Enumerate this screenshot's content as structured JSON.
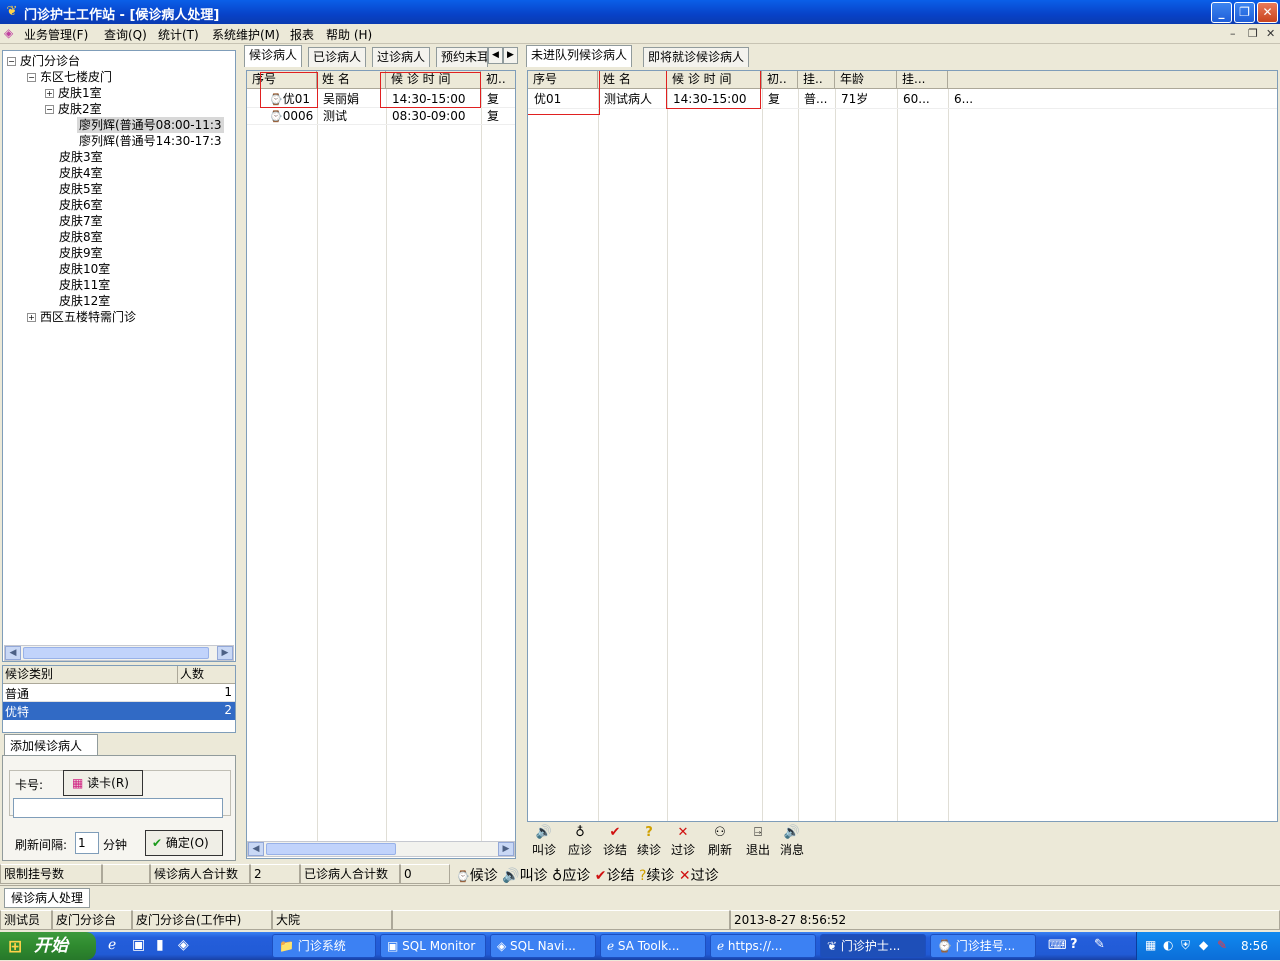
{
  "window": {
    "title": "门诊护士工作站 - [候诊病人处理]"
  },
  "menu": [
    "业务管理(F)",
    "查询(Q)",
    "统计(T)",
    "系统维护(M)",
    "报表",
    "帮助 (H)"
  ],
  "tree": {
    "root": "皮门分诊台",
    "east": "东区七楼皮门",
    "room1": "皮肤1室",
    "room2": "皮肤2室",
    "doctor1": "廖列辉(普通号08:00-11:3",
    "doctor2": "廖列辉(普通号14:30-17:3",
    "rooms": [
      "皮肤3室",
      "皮肤4室",
      "皮肤5室",
      "皮肤6室",
      "皮肤7室",
      "皮肤8室",
      "皮肤9室",
      "皮肤10室",
      "皮肤11室",
      "皮肤12室"
    ],
    "west": "西区五楼特需门诊"
  },
  "category_table": {
    "headers": [
      "候诊类别",
      "人数"
    ],
    "rows": [
      {
        "name": "普通",
        "count": "1"
      },
      {
        "name": "优特",
        "count": "2"
      }
    ]
  },
  "add_patient": {
    "tab": "添加候诊病人",
    "card_label": "卡号:",
    "read_card": "读卡(R)",
    "card_value": "",
    "interval_label": "刷新间隔:",
    "interval_value": "1",
    "interval_unit": "分钟",
    "ok": "确定(O)"
  },
  "left_tabs": [
    "候诊病人",
    "已诊病人",
    "过诊病人",
    "预约未耳"
  ],
  "left_grid": {
    "headers": [
      "序号",
      "姓  名",
      "候 诊 时 间",
      "初.."
    ],
    "rows": [
      {
        "seq": "优01",
        "name": "吴丽娟",
        "time": "14:30-15:00",
        "type": "复"
      },
      {
        "seq": "0006",
        "name": "测试",
        "time": "08:30-09:00",
        "type": "复"
      }
    ]
  },
  "right_tabs": [
    "未进队列候诊病人",
    "即将就诊候诊病人"
  ],
  "right_grid": {
    "headers": [
      "序号",
      "姓  名",
      "候 诊 时 间",
      "初..",
      "挂..",
      "年龄",
      "挂..."
    ],
    "rows": [
      {
        "seq": "优01",
        "name": "测试病人",
        "time": "14:30-15:00",
        "type": "复",
        "reg": "普...",
        "age": "71岁",
        "fee": "60...",
        "extra": "6..."
      }
    ]
  },
  "toolbar": [
    "叫诊",
    "应诊",
    "诊结",
    "续诊",
    "过诊",
    "刷新",
    "退出",
    "消息"
  ],
  "status1": {
    "limit": "限制挂号数",
    "waiting_total_label": "候诊病人合计数",
    "waiting_total": "2",
    "done_total_label": "已诊病人合计数",
    "done_total": "0",
    "legend": [
      "候诊",
      "叫诊",
      "应诊",
      "诊结",
      "续诊",
      "过诊"
    ]
  },
  "status2": {
    "tab": "候诊病人处理"
  },
  "status3": {
    "user": "测试员",
    "station": "皮门分诊台",
    "station_state": "皮门分诊台(工作中)",
    "campus": "大院",
    "datetime": "2013-8-27 8:56:52"
  },
  "taskbar": {
    "start": "开始",
    "tasks": [
      "门诊系统",
      "SQL Monitor",
      "SQL Navi...",
      "SA Toolk...",
      "https://...",
      "门诊护士...",
      "门诊挂号..."
    ],
    "clock": "8:56"
  }
}
